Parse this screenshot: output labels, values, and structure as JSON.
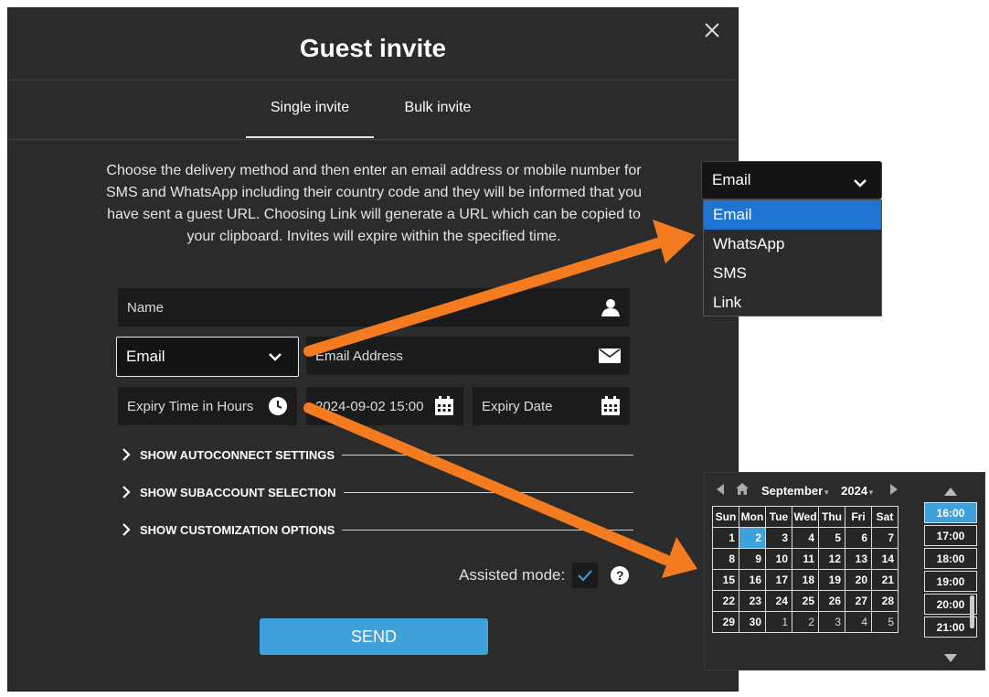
{
  "modal": {
    "title": "Guest invite",
    "tabs": [
      {
        "label": "Single invite",
        "active": true
      },
      {
        "label": "Bulk invite",
        "active": false
      }
    ],
    "description": "Choose the delivery method and then enter an email address or mobile number for SMS and WhatsApp including their country code and they will be informed that you have sent a guest URL. Choosing Link will generate a URL which can be copied to your clipboard. Invites will expire within the specified time.",
    "name_placeholder": "Name",
    "delivery_method": "Email",
    "email_placeholder": "Email Address",
    "expiry_time_placeholder": "Expiry Time in Hours",
    "expiry_datetime_value": "2024-09-02 15:00",
    "expiry_date_placeholder": "Expiry Date",
    "expanders": [
      "SHOW AUTOCONNECT SETTINGS",
      "SHOW SUBACCOUNT SELECTION",
      "SHOW CUSTOMIZATION OPTIONS"
    ],
    "assisted_mode_label": "Assisted mode:",
    "assisted_mode_checked": true,
    "help_glyph": "?",
    "send_label": "SEND"
  },
  "dropdown": {
    "selected": "Email",
    "options": [
      "Email",
      "WhatsApp",
      "SMS",
      "Link"
    ]
  },
  "calendar": {
    "month": "September",
    "year": "2024",
    "weekdays": [
      "Sun",
      "Mon",
      "Tue",
      "Wed",
      "Thu",
      "Fri",
      "Sat"
    ],
    "weeks": [
      [
        {
          "d": "1"
        },
        {
          "d": "2",
          "sel": true
        },
        {
          "d": "3"
        },
        {
          "d": "4"
        },
        {
          "d": "5"
        },
        {
          "d": "6"
        },
        {
          "d": "7"
        }
      ],
      [
        {
          "d": "8"
        },
        {
          "d": "9"
        },
        {
          "d": "10"
        },
        {
          "d": "11"
        },
        {
          "d": "12"
        },
        {
          "d": "13"
        },
        {
          "d": "14"
        }
      ],
      [
        {
          "d": "15"
        },
        {
          "d": "16"
        },
        {
          "d": "17"
        },
        {
          "d": "18"
        },
        {
          "d": "19"
        },
        {
          "d": "20"
        },
        {
          "d": "21"
        }
      ],
      [
        {
          "d": "22"
        },
        {
          "d": "23"
        },
        {
          "d": "24"
        },
        {
          "d": "25"
        },
        {
          "d": "26"
        },
        {
          "d": "27"
        },
        {
          "d": "28"
        }
      ],
      [
        {
          "d": "29"
        },
        {
          "d": "30"
        },
        {
          "d": "1",
          "other": true
        },
        {
          "d": "2",
          "other": true
        },
        {
          "d": "3",
          "other": true
        },
        {
          "d": "4",
          "other": true
        },
        {
          "d": "5",
          "other": true
        }
      ]
    ],
    "times": [
      "16:00",
      "17:00",
      "18:00",
      "19:00",
      "20:00",
      "21:00"
    ],
    "selected_time": "16:00"
  },
  "colors": {
    "accent": "#3ea1d9",
    "dropdown_highlight": "#1f74d1",
    "arrow": "#f47b20"
  }
}
